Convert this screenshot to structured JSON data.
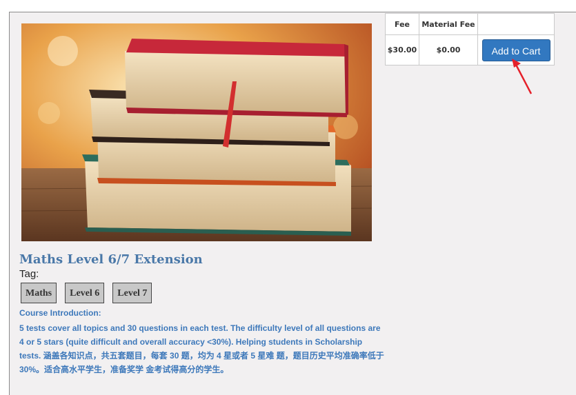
{
  "price_table": {
    "headers": [
      "Fee",
      "Material Fee",
      ""
    ],
    "fee": "$30.00",
    "material_fee": "$0.00",
    "add_to_cart_label": "Add to Cart"
  },
  "course": {
    "title": "Maths Level 6/7 Extension",
    "tag_label": "Tag:",
    "tags": [
      "Maths",
      "Level 6",
      "Level 7"
    ],
    "intro_heading": "Course Introduction:",
    "intro_text": "5 tests cover all topics and 30 questions in each test. The difficulty level of all questions are 4 or 5 stars (quite difficult and overall accuracy <30%). Helping students in Scholarship tests. 涵盖各知识点，共五套题目，每套 30 题，均为 4 星或者 5 星难 题，题目历史平均准确率低于 30%。适合高水平学生，准备奖学 金考试得高分的学生。"
  },
  "colors": {
    "accent": "#3278c0",
    "title": "#4a78a8",
    "intro": "#3d78ba",
    "arrow": "#e5202a"
  },
  "icons": {
    "arrow": "red-arrow-icon"
  }
}
